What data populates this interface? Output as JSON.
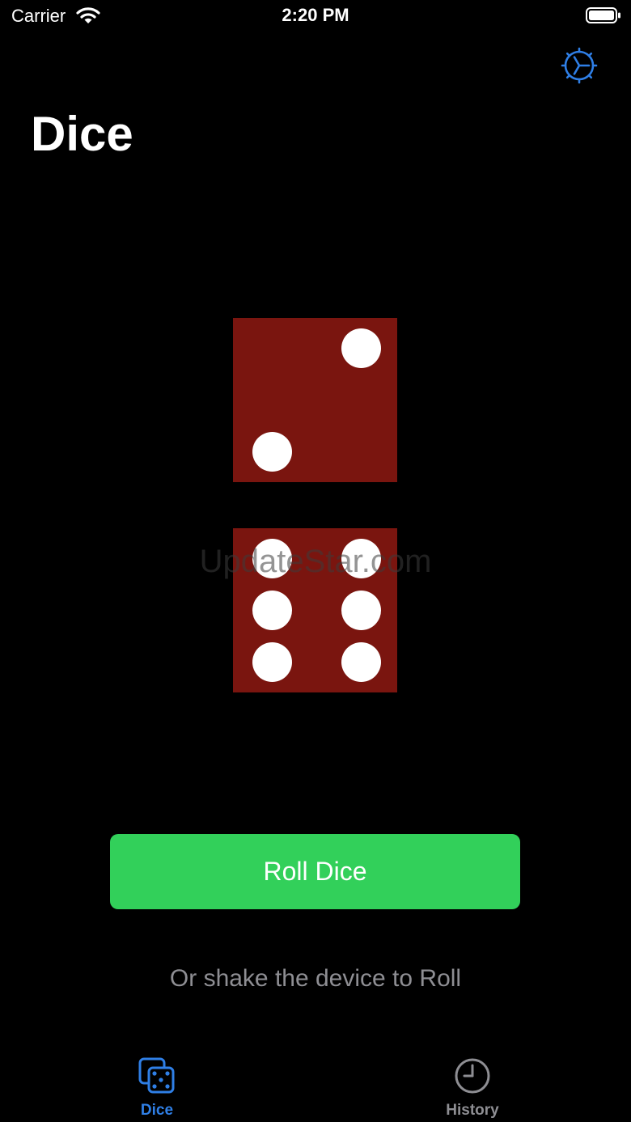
{
  "status_bar": {
    "carrier": "Carrier",
    "time": "2:20 PM",
    "wifi_icon": "wifi-icon",
    "battery_icon": "battery-icon"
  },
  "header": {
    "title": "Dice",
    "settings_icon": "gear-icon"
  },
  "dice": [
    {
      "value": 2,
      "color": "#7a150f"
    },
    {
      "value": 6,
      "color": "#7a150f"
    }
  ],
  "watermark": "UpdateStar.com",
  "roll_button": {
    "label": "Roll Dice",
    "color": "#32d05a"
  },
  "shake_hint": "Or shake the device to Roll",
  "tab_bar": {
    "tabs": [
      {
        "label": "Dice",
        "icon": "dice-icon",
        "selected": true
      },
      {
        "label": "History",
        "icon": "clock-icon",
        "selected": false
      }
    ]
  },
  "colors": {
    "accent": "#2f7fe6",
    "secondary_text": "#8e8e93",
    "background": "#000000"
  }
}
